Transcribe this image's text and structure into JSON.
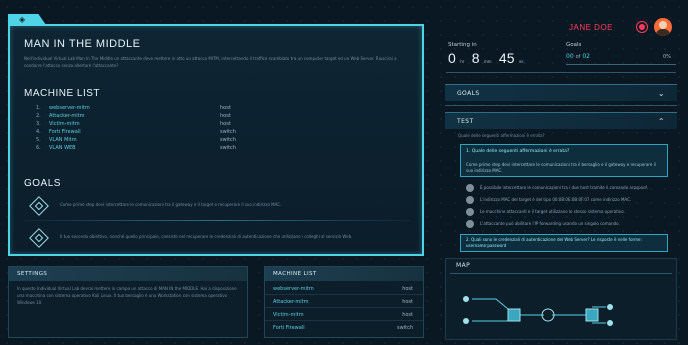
{
  "header": {
    "user_name": "JANE DOE",
    "timer_label": "Starting in",
    "timer": {
      "hours": "0",
      "hours_unit": "hr",
      "minutes": "8",
      "minutes_unit": "mm",
      "seconds": "45",
      "seconds_unit": "ss"
    },
    "goals_label": "Goals",
    "goals_done": "00",
    "goals_of": "of",
    "goals_total": "02",
    "goals_percent": "0%",
    "goals_progress": 0
  },
  "scenario": {
    "title": "MAN IN THE MIDDLE",
    "description": "Nell'individual Virtual Lab Man In The Middle un attaccante deve mettere in atto un attacco MITM, intercettando il traffico scambiato tra un computer target ed un Web Server. Riuscirai a condurre l'attacco senza allertare l'attaccante?",
    "machine_list_title": "MACHINE LIST",
    "machines": [
      {
        "index": "1.",
        "name": "webserver-mitm",
        "type": "host"
      },
      {
        "index": "2.",
        "name": "Attacker-mitm",
        "type": "host"
      },
      {
        "index": "3.",
        "name": "Victim-mitm",
        "type": "host"
      },
      {
        "index": "4.",
        "name": "Forti Firewall",
        "type": "switch"
      },
      {
        "index": "5.",
        "name": "VLAN Mitm",
        "type": "switch"
      },
      {
        "index": "6.",
        "name": "VLAN WEB",
        "type": "switch"
      }
    ],
    "goals_title": "GOALS",
    "goals": [
      {
        "text": "Come primo step devi intercettare le comunicazioni tra il gateway e il target e recuperare il suo indirizzo MAC."
      },
      {
        "text": "Il tuo secondo obiettivo, nonché quello principale, consiste nel recuperare le credenziali di autenticazione che utilizzano i colleghi al servizio Web."
      }
    ]
  },
  "settings": {
    "title": "SETTINGS",
    "text": "In questo Individual Virtual Lab devrai mettere in campo un attacco di MAN IN the MIDDLE. Hai a disposizione una macchina con sistema operativo Kali Linux. Il tuo bersaglio è una Workstation con sistema operativo Windows 10."
  },
  "machine_panel": {
    "title": "MACHINE LIST",
    "rows": [
      {
        "name": "webserver-mitm",
        "type": "host"
      },
      {
        "name": "Attacker-mitm",
        "type": "host"
      },
      {
        "name": "Victim-mitm",
        "type": "host"
      },
      {
        "name": "Forti Firewall",
        "type": "switch"
      }
    ]
  },
  "sidebar": {
    "goals_section": "GOALS",
    "test_section": "TEST",
    "test_intro": "Quale delle seguenti affermazioni è errata?",
    "question1": {
      "title": "1. Quale delle seguenti affermazioni è errata?",
      "text": "Come primo step devi intercettare le comunicazioni tra il bersaglio e il gateway e recuperare il suo indirizzo MAC.",
      "options": [
        "È possibile intercettare le comunicazioni tra i due host tramite il comando arpspoof.",
        "L'indirizzo MAC del target è del tipo 00:0B:0E:0B:0F:07 come indirizzo MAC.",
        "Le macchine attaccanti e il target utilizzano lo stesso sistema operativo.",
        "L'attaccante può abilitare l'IP forwarding usando un singolo comando."
      ]
    },
    "question2": {
      "title": "2. Quali sono le credenziali di autenticazione del Web Server? Le risposte è nelle forme: username:password"
    },
    "map_title": "MAP"
  },
  "colors": {
    "accent": "#4fd3e6",
    "user_red": "#ff3b5c",
    "background": "#0a1824"
  }
}
